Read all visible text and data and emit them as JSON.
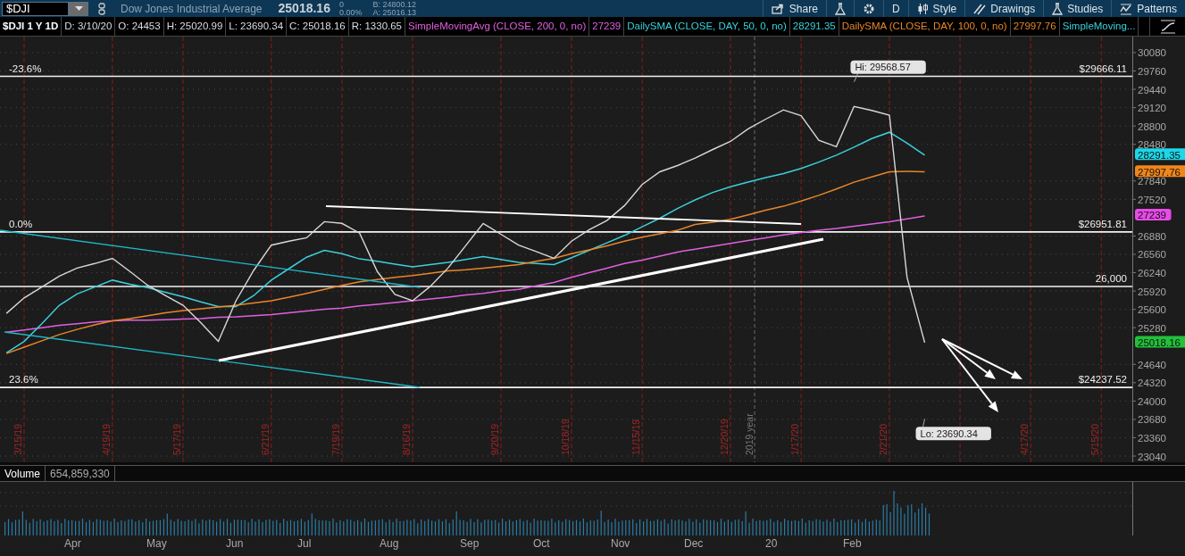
{
  "toolbar": {
    "symbol": "$DJI",
    "description": "Dow Jones Industrial Average",
    "last": "25018.16",
    "change": "0",
    "change_pct": "0.00%",
    "bid": "B: 24800.12",
    "ask": "A: 25016.13",
    "buttons": [
      {
        "kind": "share",
        "label": "Share"
      },
      {
        "kind": "flask"
      },
      {
        "kind": "gear"
      },
      {
        "kind": "period",
        "label": "D"
      },
      {
        "kind": "style",
        "label": "Style"
      },
      {
        "kind": "drawings",
        "label": "Drawings"
      },
      {
        "kind": "studies",
        "label": "Studies"
      },
      {
        "kind": "patterns",
        "label": "Patterns"
      }
    ]
  },
  "legend": {
    "fields": [
      "D: 3/10/20",
      "O: 24453",
      "H: 25020.99",
      "L: 23690.34",
      "C: 25018.16",
      "R: 1330.65"
    ],
    "values": [
      "27239",
      "28291.35",
      "27997.76"
    ],
    "more_study": "SimpleMoving..."
  },
  "chart": {
    "chart_data": {
      "type": "line",
      "categories": [
        null,
        "3/15/19",
        null,
        null,
        null,
        null,
        "4/19/19",
        null,
        null,
        null,
        "5/17/19",
        null,
        null,
        null,
        null,
        "6/21/19",
        null,
        null,
        null,
        "7/19/19",
        null,
        null,
        null,
        "8/16/19",
        null,
        null,
        null,
        null,
        "9/20/19",
        null,
        null,
        null,
        "10/18/19",
        null,
        null,
        null,
        "11/15/19",
        null,
        null,
        null,
        null,
        "12/20/19",
        null,
        null,
        null,
        "1/17/20",
        null,
        null,
        null,
        null,
        "2/21/20",
        null,
        null,
        null,
        null,
        null,
        null,
        null,
        "4/17/20",
        null,
        null,
        null,
        "5/15/20"
      ],
      "series": [
        {
          "name": "SimpleMovingAvg (CLOSE, 200, 0, no)",
          "color": "#e060e0",
          "values": [
            25200,
            25240,
            25280,
            25320,
            25350,
            25380,
            25400,
            25410,
            25410,
            25420,
            25430,
            25440,
            25460,
            25470,
            25490,
            25510,
            25540,
            25570,
            25600,
            25620,
            25660,
            25690,
            25720,
            25750,
            25780,
            25810,
            25850,
            25880,
            25920,
            25950,
            26010,
            26070,
            26160,
            26240,
            26320,
            26400,
            26460,
            26530,
            26600,
            26650,
            26700,
            26750,
            26800,
            26850,
            26900,
            26940,
            26980,
            27010,
            27050,
            27090,
            27130,
            27180,
            27230,
            null,
            null,
            null,
            null,
            null,
            null,
            null,
            null,
            null,
            null
          ]
        },
        {
          "name": "DailySMA (CLOSE, DAY, 50, 0, no)",
          "color": "#3cd0dc",
          "values": [
            24840,
            25040,
            25350,
            25670,
            25870,
            25990,
            26110,
            26040,
            25980,
            25900,
            25820,
            25730,
            25650,
            25650,
            25840,
            26110,
            26310,
            26510,
            26630,
            26570,
            26480,
            26440,
            26390,
            26340,
            26380,
            26420,
            26470,
            26520,
            26470,
            26420,
            26400,
            26380,
            26500,
            26630,
            26760,
            26890,
            27040,
            27190,
            27360,
            27510,
            27640,
            27740,
            27820,
            27900,
            27970,
            28060,
            28170,
            28290,
            28430,
            28580,
            28690,
            28500,
            28290,
            null,
            null,
            null,
            null,
            null,
            null,
            null,
            null,
            null,
            null
          ]
        },
        {
          "name": "DailySMA (CLOSE, DAY, 100, 0, no)",
          "color": "#e8862a",
          "values": [
            24830,
            24940,
            25050,
            25160,
            25250,
            25330,
            25400,
            25440,
            25490,
            25540,
            25580,
            25610,
            25640,
            25670,
            25710,
            25750,
            25810,
            25880,
            25950,
            26020,
            26080,
            26120,
            26160,
            26190,
            26230,
            26270,
            26290,
            26320,
            26350,
            26380,
            26440,
            26490,
            26570,
            26640,
            26710,
            26790,
            26860,
            26920,
            26980,
            27080,
            27120,
            27170,
            27250,
            27330,
            27400,
            27490,
            27590,
            27700,
            27820,
            27910,
            28000,
            28010,
            28000,
            null,
            null,
            null,
            null,
            null,
            null,
            null,
            null,
            null,
            null
          ]
        },
        {
          "name": "$DJI 1 Y 1D",
          "color": "#d8d8d8",
          "values": [
            25530,
            25800,
            25990,
            26180,
            26320,
            26400,
            26490,
            26260,
            26020,
            25840,
            25670,
            25370,
            25040,
            25750,
            26280,
            26720,
            26790,
            26850,
            27130,
            27100,
            26930,
            26260,
            25860,
            25750,
            26000,
            26320,
            26710,
            27100,
            26910,
            26720,
            26610,
            26490,
            26790,
            26990,
            27150,
            27410,
            27780,
            28000,
            28110,
            28240,
            28390,
            28530,
            28750,
            28920,
            29080,
            28980,
            28550,
            28440,
            29140,
            29070,
            28990,
            26160,
            25020,
            null,
            null,
            null,
            null,
            null,
            null,
            null,
            null,
            null,
            null
          ]
        }
      ],
      "ylim": [
        22931,
        30360
      ],
      "grid": true,
      "yticks": [
        23040,
        23360,
        23680,
        24000,
        24320,
        24640,
        25280,
        25600,
        25920,
        26240,
        26560,
        26880,
        27520,
        27840,
        28480,
        28800,
        29120,
        29440,
        29760,
        30080
      ]
    },
    "levels": [
      {
        "label": "$29666.11",
        "fib": "-23.6%"
      },
      {
        "label": "$26951.81",
        "fib": "0.0%"
      },
      {
        "label": "26,000"
      },
      {
        "label": "$24237.52",
        "fib": "23.6%"
      }
    ],
    "callouts": [
      {
        "label": "Hi: 29568.57"
      },
      {
        "label": "Lo: 23690.34"
      }
    ],
    "period_label": "2019 year",
    "price_badges": [
      {
        "label": "28291.35",
        "color": "#1ed6e6"
      },
      {
        "label": "27997.76",
        "color": "#f0861a"
      },
      {
        "label": "27239",
        "color": "#e84be8"
      },
      {
        "label": "25018.16",
        "color": "#22c13a"
      }
    ]
  },
  "volume": {
    "label": "Volume",
    "value": "654,859,330",
    "months": [
      "Apr",
      "May",
      "Jun",
      "Jul",
      "Aug",
      "Sep",
      "Oct",
      "Nov",
      "Dec",
      "20",
      "Feb"
    ]
  }
}
